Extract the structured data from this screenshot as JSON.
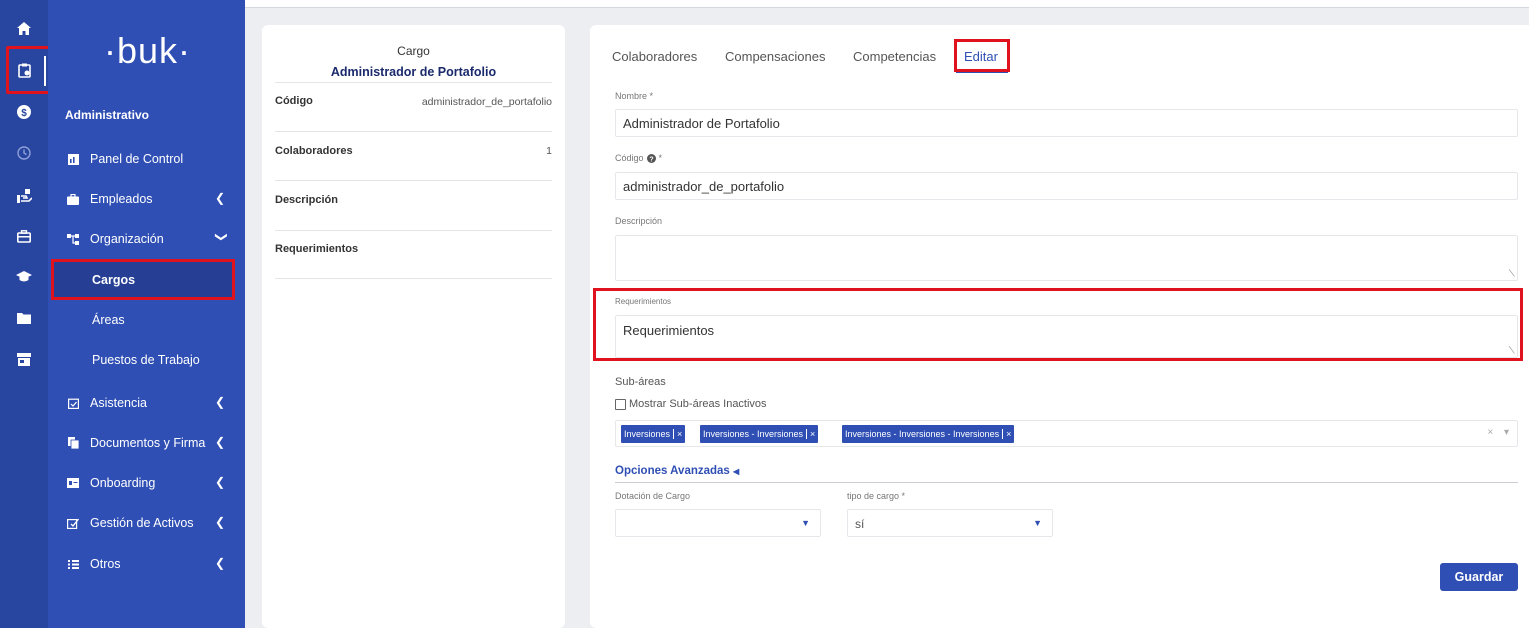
{
  "brand": {
    "logo": "·buk·"
  },
  "sidebar": {
    "section": "Administrativo",
    "items": [
      {
        "label": "Panel de Control",
        "icon": "dashboard-icon"
      },
      {
        "label": "Empleados",
        "icon": "briefcase-icon"
      },
      {
        "label": "Organización",
        "icon": "org-chart-icon"
      },
      {
        "label": "Asistencia",
        "icon": "calendar-check-icon"
      },
      {
        "label": "Documentos y Firma",
        "icon": "documents-icon"
      },
      {
        "label": "Onboarding",
        "icon": "id-card-icon"
      },
      {
        "label": "Gestión de Activos",
        "icon": "assets-icon"
      },
      {
        "label": "Otros",
        "icon": "grid-icon"
      }
    ],
    "sub_items": [
      "Cargos",
      "Áreas",
      "Puestos de Trabajo"
    ]
  },
  "info_card": {
    "caption": "Cargo",
    "title": "Administrador de Portafolio",
    "rows": [
      {
        "label": "Código",
        "value": "administrador_de_portafolio"
      },
      {
        "label": "Colaboradores",
        "value": "1"
      },
      {
        "label": "Descripción",
        "value": ""
      },
      {
        "label": "Requerimientos",
        "value": ""
      }
    ]
  },
  "tabs": [
    "Colaboradores",
    "Compensaciones",
    "Competencias",
    "Editar"
  ],
  "form": {
    "nombre_label": "Nombre *",
    "nombre_value": "Administrador de Portafolio",
    "codigo_label": "Código",
    "codigo_req": "*",
    "codigo_value": "administrador_de_portafolio",
    "descripcion_label": "Descripción",
    "descripcion_value": "",
    "requerimientos_label": "Requerimientos",
    "requerimientos_value": "Requerimientos",
    "subareas_label": "Sub-áreas",
    "show_inactive_label": "Mostrar Sub-áreas Inactivos",
    "tags": [
      "Inversiones",
      "Inversiones - Inversiones",
      "Inversiones - Inversiones - Inversiones"
    ],
    "tag_remove": "×",
    "clear_all": "×",
    "advanced_label": "Opciones Avanzadas",
    "dotacion_label": "Dotación de Cargo",
    "dotacion_value": "",
    "tipo_label": "tipo de cargo *",
    "tipo_value": "sí",
    "save_label": "Guardar"
  },
  "colors": {
    "accent": "#2f4fb4",
    "rail": "#2845a0",
    "highlight": "#e0121e"
  }
}
